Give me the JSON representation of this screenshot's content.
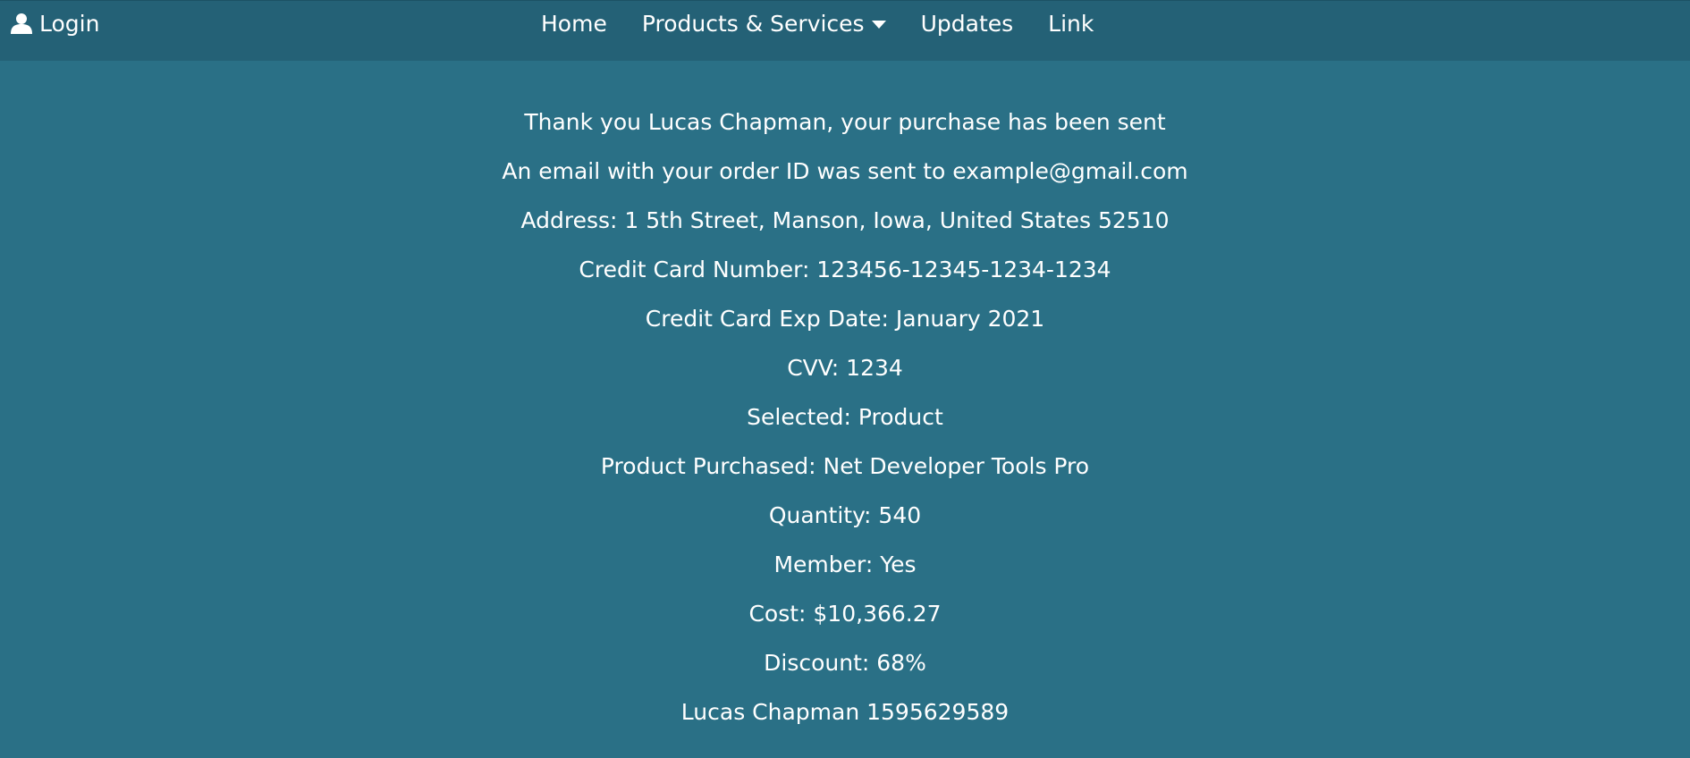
{
  "nav": {
    "login_label": "Login",
    "links": {
      "home": "Home",
      "products": "Products & Services",
      "updates": "Updates",
      "link": "Link"
    }
  },
  "confirmation": {
    "thank_you": "Thank you Lucas Chapman, your purchase has been sent",
    "email_notice": "An email with your order ID was sent to example@gmail.com",
    "address": "Address: 1 5th Street, Manson, Iowa, United States 52510",
    "card_number": "Credit Card Number: 123456-12345-1234-1234",
    "card_exp": "Credit Card Exp Date: January 2021",
    "cvv": "CVV: 1234",
    "selected": "Selected: Product",
    "product": "Product Purchased: Net Developer Tools Pro",
    "quantity": "Quantity: 540",
    "member": "Member: Yes",
    "cost": "Cost: $10,366.27",
    "discount": "Discount: 68%",
    "signature": "Lucas Chapman 1595629589"
  },
  "colors": {
    "background": "#2a7086",
    "navbar": "#246176",
    "text": "#ffffff"
  },
  "icons": {
    "login": "user-icon",
    "products_dropdown": "caret-down-icon"
  }
}
